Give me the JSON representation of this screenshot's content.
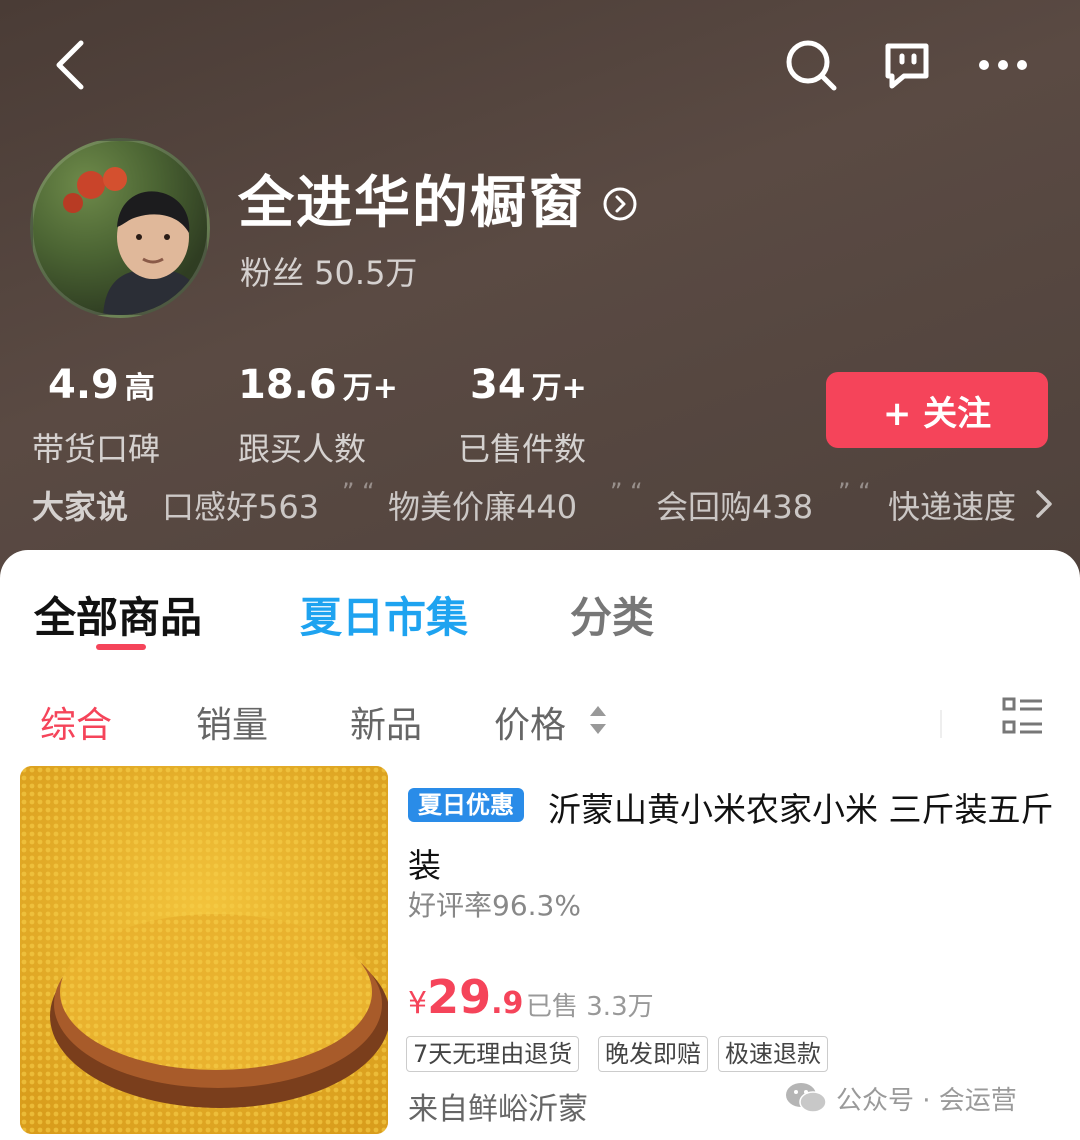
{
  "store": {
    "name": "全进华的橱窗",
    "fans": "粉丝 50.5万"
  },
  "stats": [
    {
      "value": "4.9",
      "unit": "高",
      "label": "带货口碑"
    },
    {
      "value": "18.6",
      "unit": "万+",
      "label": "跟买人数"
    },
    {
      "value": "34",
      "unit": "万+",
      "label": "已售件数"
    }
  ],
  "follow_label": "+ 关注",
  "reviews": {
    "title": "大家说",
    "items": [
      "口感好563",
      "物美价廉440",
      "会回购438",
      "快递速度"
    ]
  },
  "tabs": [
    "全部商品",
    "夏日市集",
    "分类"
  ],
  "sort": [
    "综合",
    "销量",
    "新品",
    "价格"
  ],
  "product": {
    "badge": "夏日优惠",
    "title": "沂蒙山黄小米农家小米 三斤装五斤装",
    "rating": "好评率96.3%",
    "price_symbol": "¥",
    "price_int": "29",
    "price_dec": ".9",
    "sold": "已售 3.3万",
    "tags": [
      "7天无理由退货",
      "晚发即赔",
      "极速退款"
    ],
    "source": "来自鲜峪沂蒙"
  },
  "watermark": "公众号 · 会运营",
  "colors": {
    "accent": "#f5445a",
    "summer_blue": "#1ea3f0",
    "badge_blue": "#2a8ce8"
  }
}
